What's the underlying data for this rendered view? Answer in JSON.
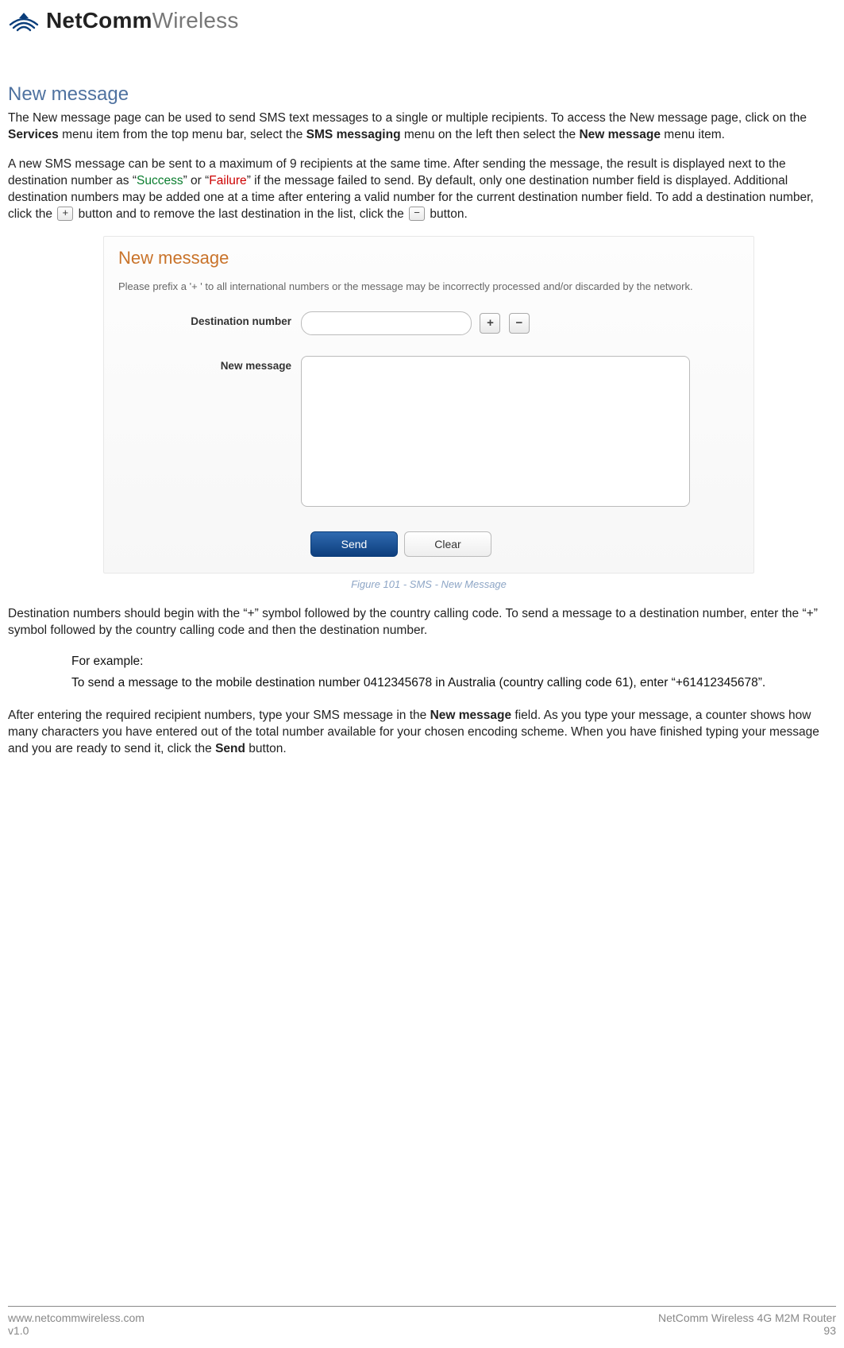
{
  "brand": {
    "strong": "NetComm",
    "light": "Wireless"
  },
  "section_title": "New message",
  "para1": {
    "a": "The New message page can be used to send SMS text messages to a single or multiple recipients. To access the New message page, click on the ",
    "b": "Services",
    "c": " menu item from the top menu bar, select the ",
    "d": "SMS messaging",
    "e": " menu on the left then select the ",
    "f": "New message",
    "g": " menu item."
  },
  "para2": {
    "a": "A new SMS message can be sent to a maximum of 9 recipients at the same time. After sending the message, the result is displayed next to the destination number as “",
    "success": "Success",
    "b": "” or “",
    "failure": "Failure",
    "c": "” if the message failed to send. By default, only one destination number field is displayed. Additional destination numbers may be added one at a time after entering a valid number for the current destination number field. To add a destination number, click the ",
    "plus": "+",
    "d": " button and to remove the last destination in the list, click the ",
    "minus": "−",
    "e": " button."
  },
  "figure": {
    "title": "New message",
    "note": "Please prefix a '+ ' to all international numbers or the message may be incorrectly processed and/or discarded by the network.",
    "dest_label": "Destination number",
    "msg_label": "New message",
    "plus": "+",
    "minus": "−",
    "send": "Send",
    "clear": "Clear",
    "caption": "Figure 101 - SMS - New Message"
  },
  "para3": "Destination numbers should begin with the “+” symbol followed by the country calling code. To send a message to a destination number, enter the “+” symbol followed by the country calling code and then the destination number.",
  "example1": "For example:",
  "example2": "To send a message to the mobile destination number 0412345678 in Australia (country calling code 61), enter “+61412345678”.",
  "para4": {
    "a": "After entering the required recipient numbers, type your SMS message in the ",
    "b": "New message",
    "c": " field. As you type your message, a counter shows how many characters you have entered out of the total number available for your chosen encoding scheme. When you have finished typing your message and you are ready to send it, click the ",
    "d": "Send",
    "e": " button."
  },
  "footer": {
    "url": "www.netcommwireless.com",
    "version": "v1.0",
    "product": "NetComm Wireless 4G M2M Router",
    "page": "93"
  }
}
